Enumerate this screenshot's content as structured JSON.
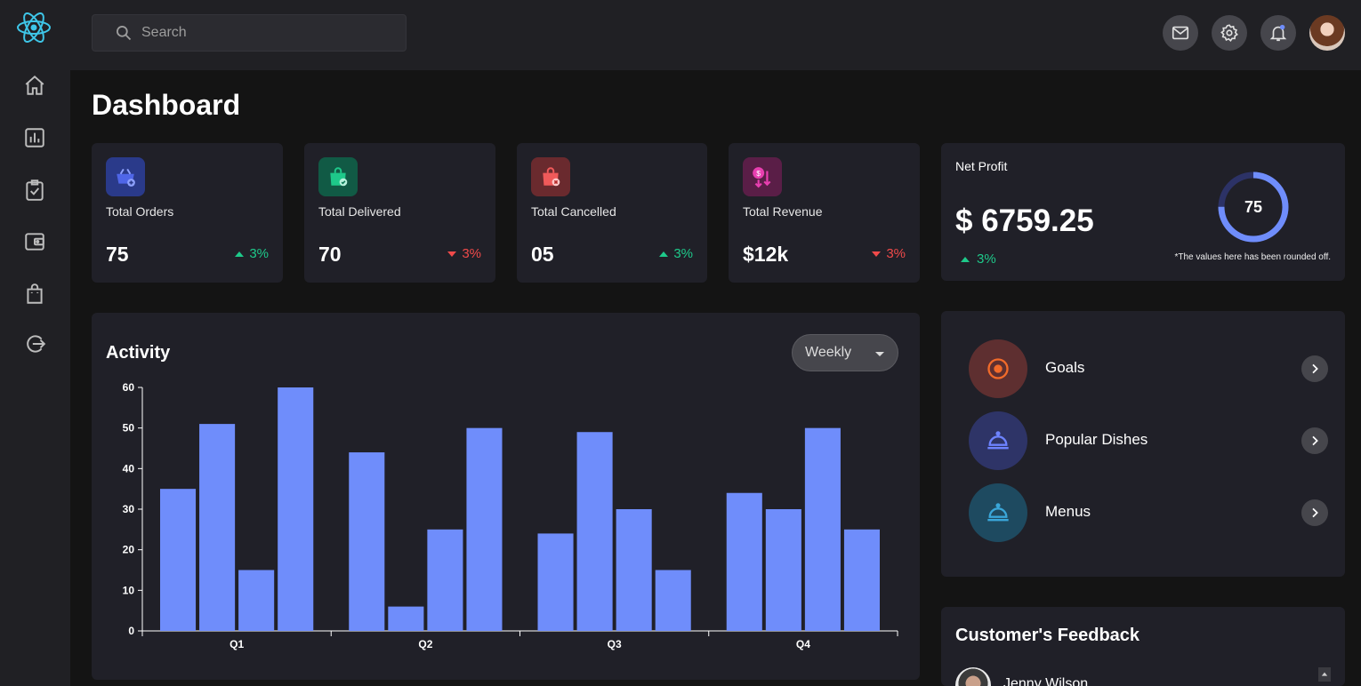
{
  "search": {
    "placeholder": "Search"
  },
  "page": {
    "title": "Dashboard"
  },
  "stats": [
    {
      "label": "Total Orders",
      "value": "75",
      "trend": "3%",
      "direction": "up",
      "icon": "basket-add-icon",
      "badge_color": "#2a3a8a",
      "icon_color": "#6d83ff"
    },
    {
      "label": "Total Delivered",
      "value": "70",
      "trend": "3%",
      "direction": "down",
      "icon": "bag-check-icon",
      "badge_color": "#115a45",
      "icon_color": "#1ec98a"
    },
    {
      "label": "Total Cancelled",
      "value": "05",
      "trend": "3%",
      "direction": "up",
      "icon": "bag-cancel-icon",
      "badge_color": "#6a2a2e",
      "icon_color": "#f05a5a"
    },
    {
      "label": "Total Revenue",
      "value": "$12k",
      "trend": "3%",
      "direction": "down",
      "icon": "revenue-down-icon",
      "badge_color": "#5a1e47",
      "icon_color": "#e83fb0"
    }
  ],
  "net_profit": {
    "label": "Net Profit",
    "value": "$ 6759.25",
    "trend": "3%",
    "ring_value": "75",
    "ring_percent": 75,
    "note": "*The values here has been rounded off."
  },
  "activity": {
    "title": "Activity",
    "period": "Weekly"
  },
  "chart_data": {
    "type": "bar",
    "categories": [
      "Q1",
      "Q2",
      "Q3",
      "Q4"
    ],
    "series_values": [
      [
        35,
        51,
        15,
        60
      ],
      [
        44,
        6,
        25,
        50
      ],
      [
        24,
        49,
        30,
        15
      ],
      [
        34,
        30,
        50,
        25
      ]
    ],
    "ylim": [
      0,
      60
    ],
    "yticks": [
      0,
      10,
      20,
      30,
      40,
      50,
      60
    ],
    "bar_color": "#6f8dfb",
    "grid": false
  },
  "links": [
    {
      "label": "Goals",
      "icon": "target-icon",
      "bg": "#5e2f30",
      "color": "#f26b2a"
    },
    {
      "label": "Popular Dishes",
      "icon": "dish-cloche-icon",
      "bg": "#2e3467",
      "color": "#6d83ff"
    },
    {
      "label": "Menus",
      "icon": "menu-cloche-icon",
      "bg": "#1e4a60",
      "color": "#3aa6d8"
    }
  ],
  "feedback": {
    "title": "Customer's Feedback",
    "first_name": "Jenny Wilson"
  },
  "colors": {
    "accent": "#6f8dfb",
    "up": "#1ec98a",
    "down": "#f04a4a",
    "logo": "#3ec6e8"
  }
}
